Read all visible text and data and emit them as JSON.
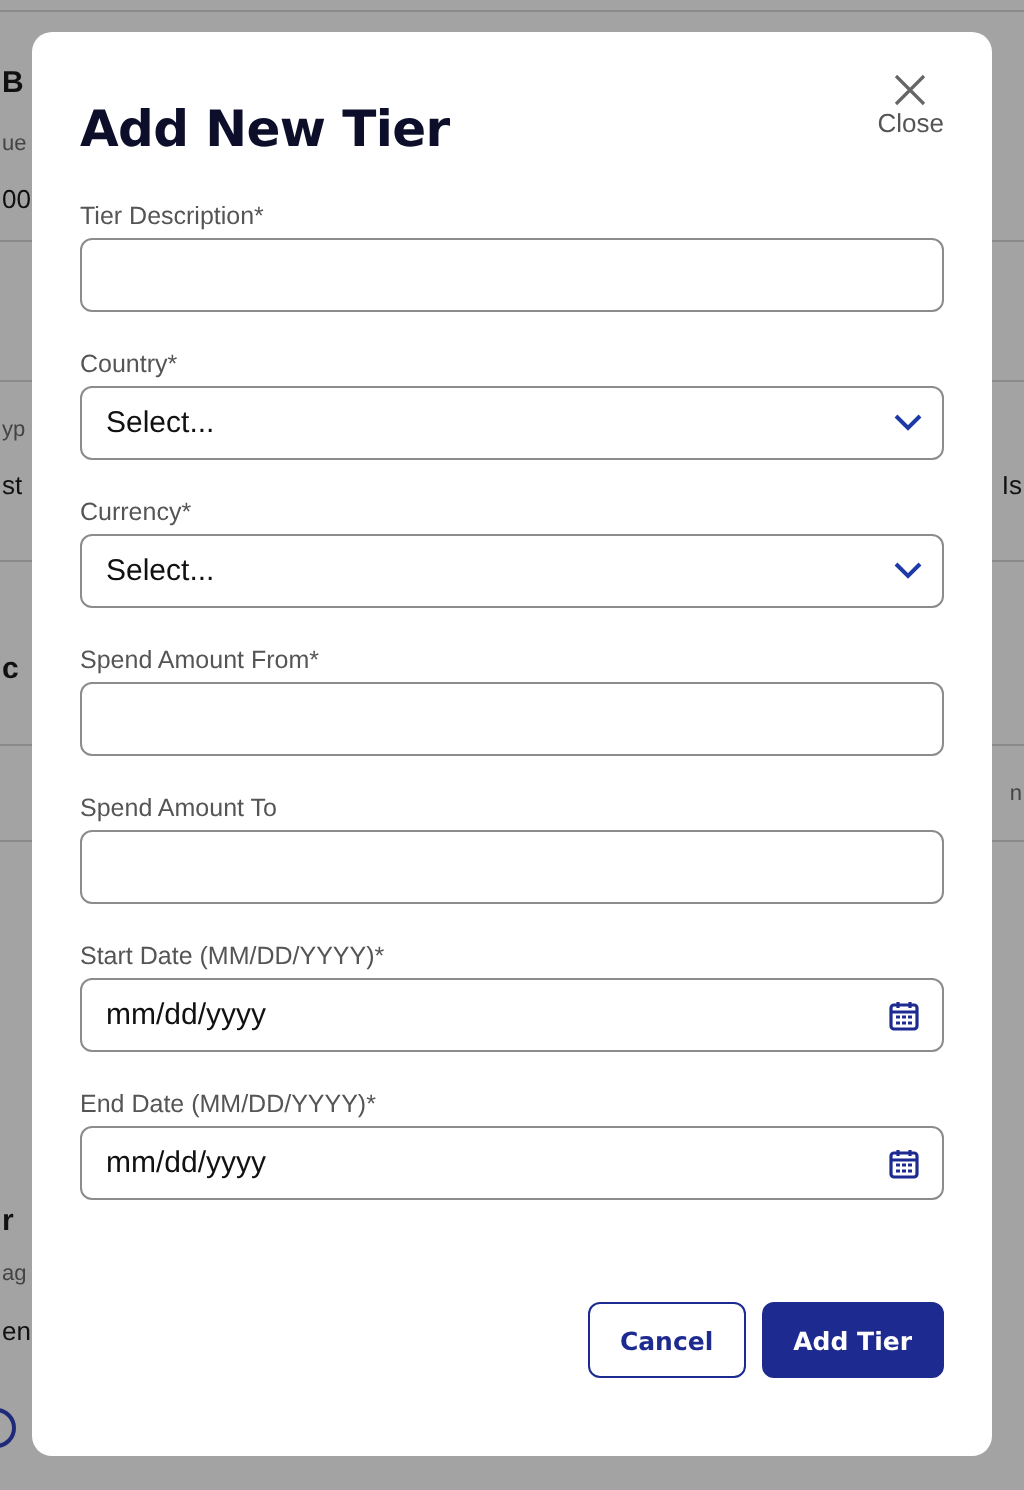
{
  "background": {
    "left_column": [
      {
        "text": "B",
        "kind": "heading"
      },
      {
        "text": "ue",
        "kind": "label"
      },
      {
        "text": "00",
        "kind": "value"
      },
      {
        "text": "yp",
        "kind": "label"
      },
      {
        "text": "st",
        "kind": "value"
      },
      {
        "text": "c",
        "kind": "heading"
      },
      {
        "text": "r",
        "kind": "heading"
      },
      {
        "text": "ag",
        "kind": "label"
      },
      {
        "text": "en",
        "kind": "value"
      }
    ],
    "right_column": [
      {
        "text": "Is",
        "kind": "value"
      },
      {
        "text": "n",
        "kind": "label"
      }
    ]
  },
  "dialog": {
    "title": "Add New Tier",
    "close_label": "Close",
    "fields": [
      {
        "kind": "text",
        "label": "Tier Description*"
      },
      {
        "kind": "select",
        "label": "Country*",
        "value": "Select..."
      },
      {
        "kind": "select",
        "label": "Currency*",
        "value": "Select..."
      },
      {
        "kind": "text",
        "label": "Spend Amount From*"
      },
      {
        "kind": "text",
        "label": "Spend Amount To"
      },
      {
        "kind": "date",
        "label": "Start Date (MM/DD/YYYY)*",
        "placeholder": "mm/dd/yyyy"
      },
      {
        "kind": "date",
        "label": "End Date (MM/DD/YYYY)*",
        "placeholder": "mm/dd/yyyy"
      }
    ],
    "buttons": [
      {
        "label": "Cancel",
        "kind": "secondary"
      },
      {
        "label": "Add Tier",
        "kind": "primary"
      }
    ]
  }
}
